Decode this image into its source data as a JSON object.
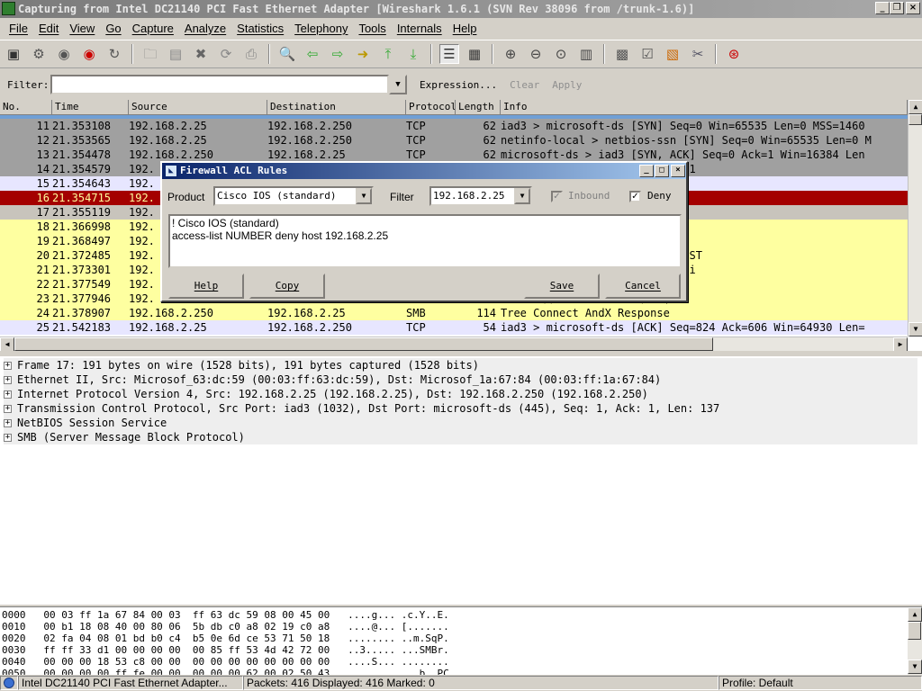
{
  "window": {
    "title": "Capturing from Intel DC21140 PCI Fast Ethernet Adapter   [Wireshark 1.6.1  (SVN Rev 38096 from /trunk-1.6)]"
  },
  "menu": [
    "File",
    "Edit",
    "View",
    "Go",
    "Capture",
    "Analyze",
    "Statistics",
    "Telephony",
    "Tools",
    "Internals",
    "Help"
  ],
  "filter": {
    "label": "Filter:",
    "value": "",
    "expression": "Expression...",
    "clear": "Clear",
    "apply": "Apply"
  },
  "packet_list": {
    "columns": [
      "No.",
      "Time",
      "Source",
      "Destination",
      "Protocol",
      "Length",
      "Info"
    ],
    "rows": [
      {
        "no": "11",
        "time": "21.353108",
        "src": "192.168.2.25",
        "dst": "192.168.2.250",
        "proto": "TCP",
        "len": "62",
        "info": "iad3 > microsoft-ds [SYN] Seq=0 Win=65535 Len=0 MSS=1460",
        "bg": "#a0a0a0",
        "fg": "#000000"
      },
      {
        "no": "12",
        "time": "21.353565",
        "src": "192.168.2.25",
        "dst": "192.168.2.250",
        "proto": "TCP",
        "len": "62",
        "info": "netinfo-local > netbios-ssn [SYN] Seq=0 Win=65535 Len=0 M",
        "bg": "#a0a0a0",
        "fg": "#000000"
      },
      {
        "no": "13",
        "time": "21.354478",
        "src": "192.168.2.250",
        "dst": "192.168.2.25",
        "proto": "TCP",
        "len": "62",
        "info": "microsoft-ds > iad3 [SYN, ACK] Seq=0 Ack=1 Win=16384 Len",
        "bg": "#a0a0a0",
        "fg": "#000000"
      },
      {
        "no": "14",
        "time": "21.354579",
        "src": "192.",
        "dst": "",
        "proto": "",
        "len": "",
        "info": "l [SYN, ACK] Seq=0 Ack=1 Win=1",
        "bg": "#a0a0a0",
        "fg": "#000000"
      },
      {
        "no": "15",
        "time": "21.354643",
        "src": "192.",
        "dst": "",
        "proto": "",
        "len": "",
        "info": "Seq=1 Ack=1 Win=65535 Len=0",
        "bg": "#e7e6ff",
        "fg": "#000000"
      },
      {
        "no": "16",
        "time": "21.354715",
        "src": "192.",
        "dst": "",
        "proto": "",
        "len": "",
        "info": "n [RST] Seq=1 Win=0 Len=0",
        "bg": "#a40000",
        "fg": "#fffc9c"
      },
      {
        "no": "17",
        "time": "21.355119",
        "src": "192.",
        "dst": "",
        "proto": "",
        "len": "",
        "info": "",
        "bg": "#c8c4bc",
        "fg": "#000000"
      },
      {
        "no": "18",
        "time": "21.366998",
        "src": "192.",
        "dst": "",
        "proto": "",
        "len": "",
        "info": "e",
        "bg": "#feffa0",
        "fg": "#000000"
      },
      {
        "no": "19",
        "time": "21.368497",
        "src": "192.",
        "dst": "",
        "proto": "",
        "len": "",
        "info": ", NTLMSSP_NEGOTIATE",
        "bg": "#feffa0",
        "fg": "#000000"
      },
      {
        "no": "20",
        "time": "21.372485",
        "src": "192.",
        "dst": "",
        "proto": "",
        "len": "",
        "info": "e, NTLMSSP_CHALLENGE, Error: ST",
        "bg": "#feffa0",
        "fg": "#000000"
      },
      {
        "no": "21",
        "time": "21.373301",
        "src": "192.",
        "dst": "",
        "proto": "",
        "len": "",
        "info": ", NTLMSSP_AUTH, User: HXW\\admi",
        "bg": "#feffa0",
        "fg": "#000000"
      },
      {
        "no": "22",
        "time": "21.377549",
        "src": "192.",
        "dst": "",
        "proto": "",
        "len": "",
        "info": "e",
        "bg": "#feffa0",
        "fg": "#000000"
      },
      {
        "no": "23",
        "time": "21.377946",
        "src": "192.",
        "dst": "",
        "proto": "",
        "len": "",
        "info": "Path: \\\\192.168.2.250\\IPC$",
        "bg": "#feffa0",
        "fg": "#000000"
      },
      {
        "no": "24",
        "time": "21.378907",
        "src": "192.168.2.250",
        "dst": "192.168.2.25",
        "proto": "SMB",
        "len": "114",
        "info": "Tree Connect AndX Response",
        "bg": "#feffa0",
        "fg": "#000000"
      },
      {
        "no": "25",
        "time": "21.542183",
        "src": "192.168.2.25",
        "dst": "192.168.2.250",
        "proto": "TCP",
        "len": "54",
        "info": "iad3 > microsoft-ds [ACK] Seq=824 Ack=606 Win=64930 Len=",
        "bg": "#e7e6ff",
        "fg": "#000000"
      }
    ]
  },
  "details": [
    "Frame 17: 191 bytes on wire (1528 bits), 191 bytes captured (1528 bits)",
    "Ethernet II, Src: Microsof_63:dc:59 (00:03:ff:63:dc:59), Dst: Microsof_1a:67:84 (00:03:ff:1a:67:84)",
    "Internet Protocol Version 4, Src: 192.168.2.25 (192.168.2.25), Dst: 192.168.2.250 (192.168.2.250)",
    "Transmission Control Protocol, Src Port: iad3 (1032), Dst Port: microsoft-ds (445), Seq: 1, Ack: 1, Len: 137",
    "NetBIOS Session Service",
    "SMB (Server Message Block Protocol)"
  ],
  "bytes": [
    "0000   00 03 ff 1a 67 84 00 03  ff 63 dc 59 08 00 45 00   ....g... .c.Y..E.",
    "0010   00 b1 18 08 40 00 80 06  5b db c0 a8 02 19 c0 a8   ....@... [.......",
    "0020   02 fa 04 08 01 bd b0 c4  b5 0e 6d ce 53 71 50 18   ........ ..m.SqP.",
    "0030   ff ff 33 d1 00 00 00 00  00 85 ff 53 4d 42 72 00   ..3..... ...SMBr.",
    "0040   00 00 00 18 53 c8 00 00  00 00 00 00 00 00 00 00   ....S... ........",
    "0050   00 00 00 00 ff fe 00 00  00 00 00 62 00 02 50 43   ........ ...b..PC"
  ],
  "status": {
    "adapter": "Intel DC21140 PCI Fast Ethernet Adapter...",
    "packets": "Packets: 416 Displayed: 416 Marked: 0",
    "profile": "Profile: Default"
  },
  "dialog": {
    "title": "Firewall ACL Rules",
    "product_label": "Product",
    "product_value": "Cisco IOS (standard)",
    "filter_label": "Filter",
    "filter_value": "192.168.2.25",
    "inbound_label": "Inbound",
    "deny_label": "Deny",
    "rules_text": "! Cisco IOS (standard)\naccess-list NUMBER deny host 192.168.2.25",
    "help": "Help",
    "copy": "Copy",
    "save": "Save",
    "cancel": "Cancel"
  }
}
